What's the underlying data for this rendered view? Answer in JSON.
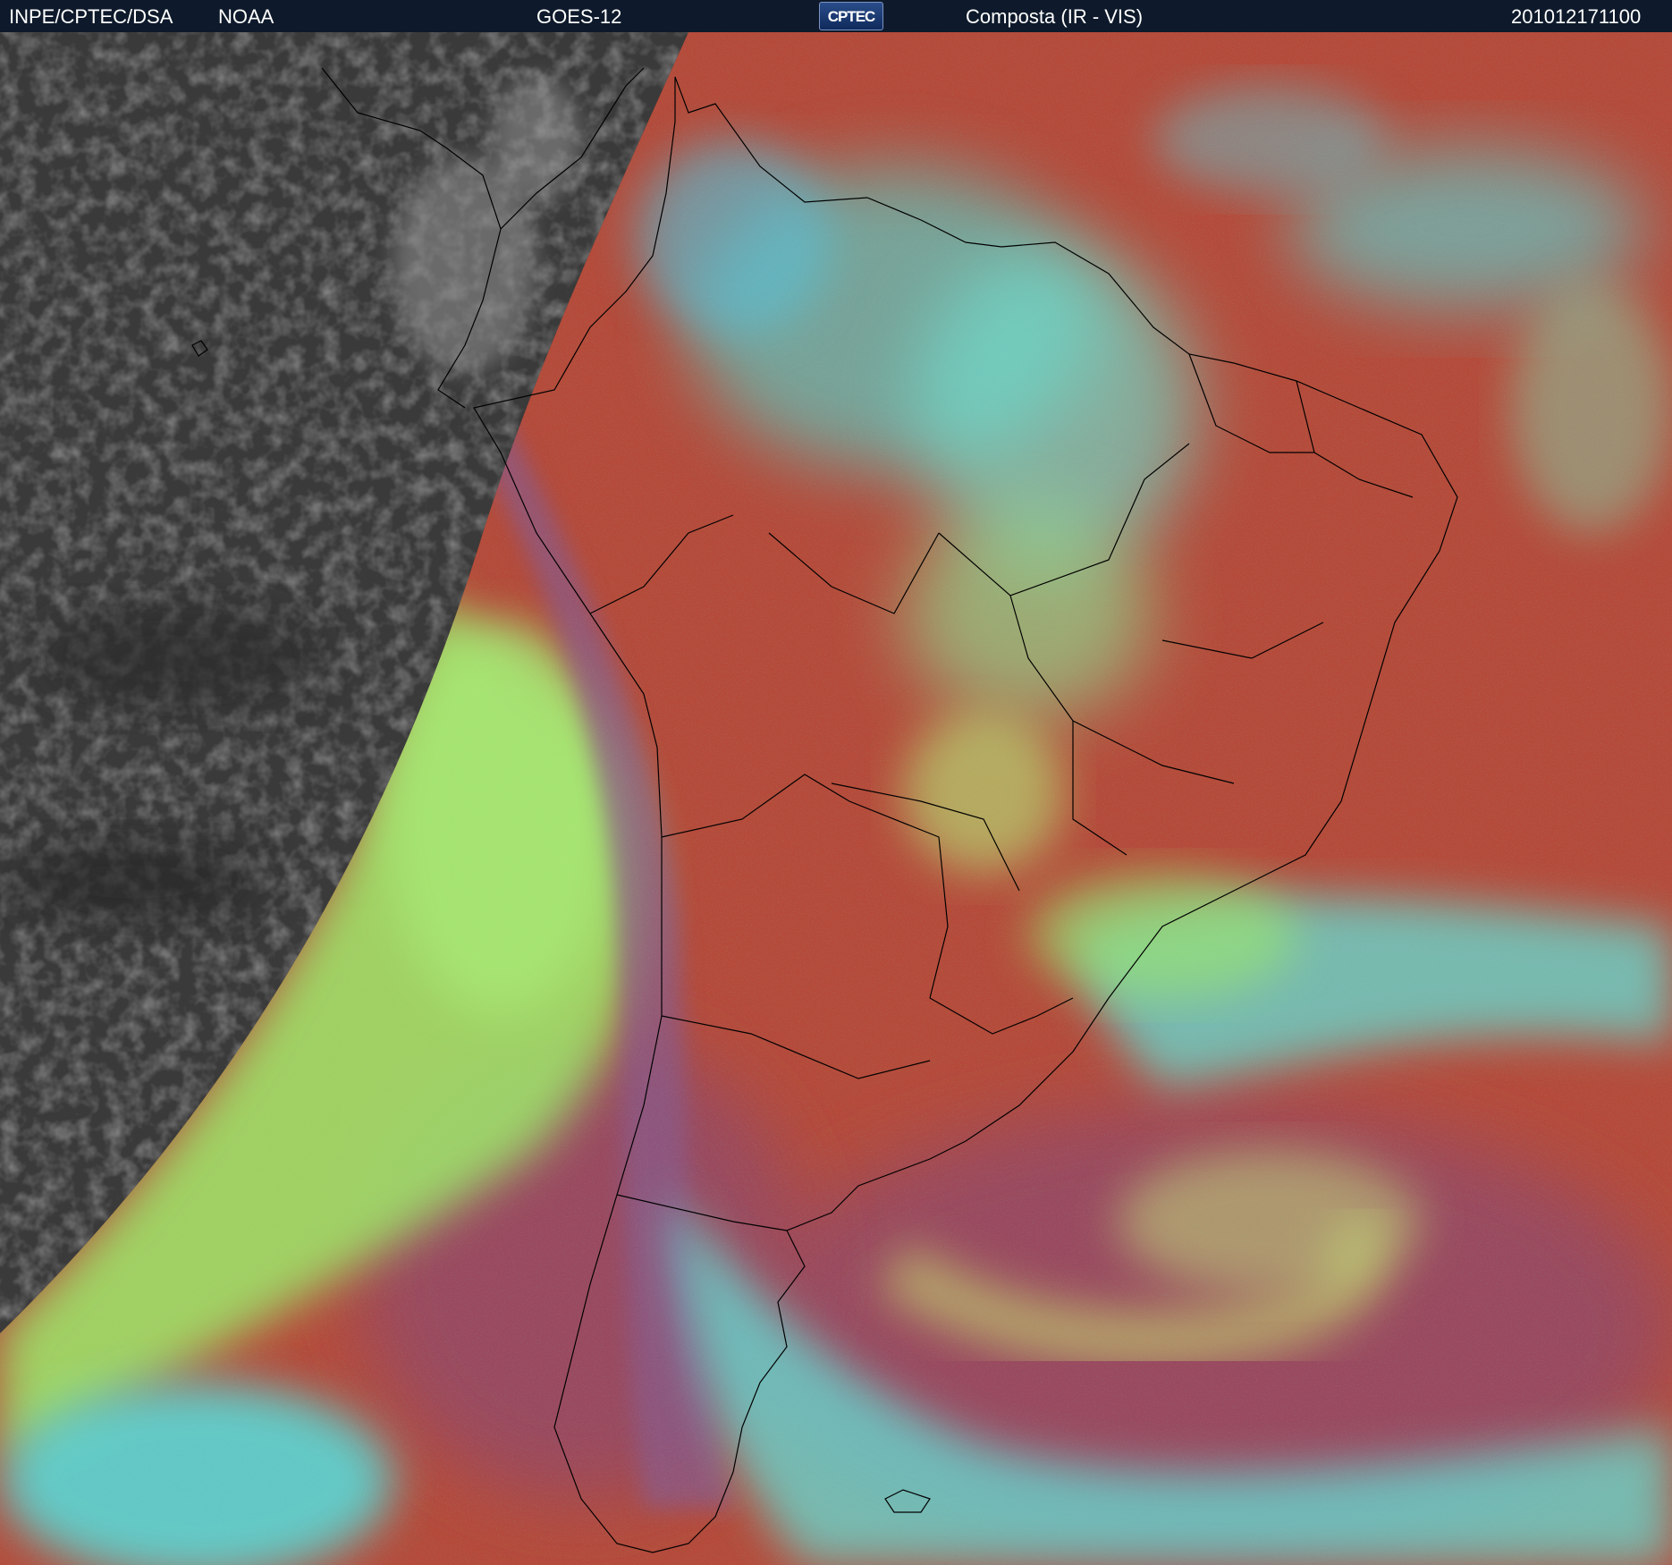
{
  "header": {
    "institute": "INPE/CPTEC/DSA",
    "agency": "NOAA",
    "satellite": "GOES-12",
    "logo": "CPTEC",
    "product": "Composta (IR - VIS)",
    "timestamp": "201012171100"
  },
  "colors": {
    "header_bg": "#0e1a2b",
    "night_ir": "#3a3a3a",
    "land_clear": "#b54a3a",
    "high_cloud": "#38e8e0",
    "low_cloud": "#9ee86a",
    "ocean_clear": "#9a4a5e",
    "borders": "#000000"
  }
}
